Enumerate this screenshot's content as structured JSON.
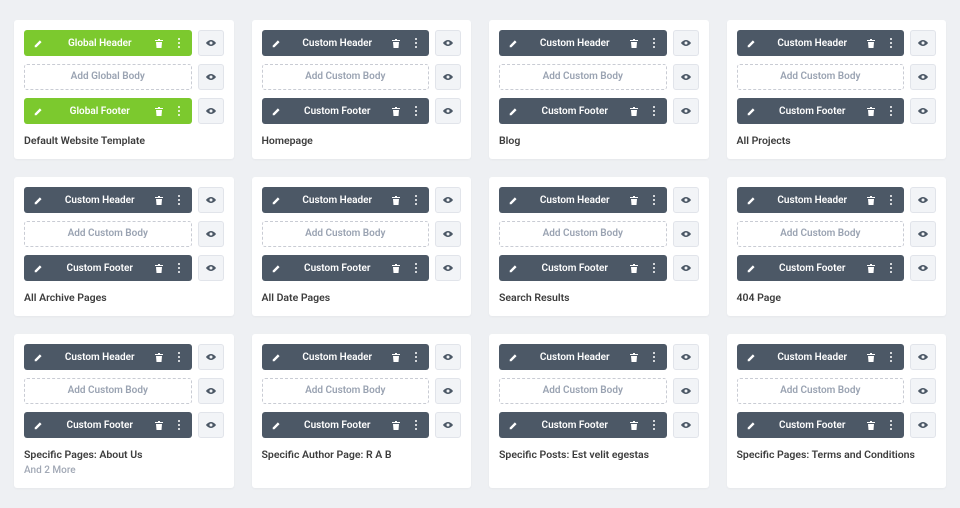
{
  "labels": {
    "and_more": "And 2 More"
  },
  "templates": [
    {
      "title": "Default Website Template",
      "header_label": "Global Header",
      "body_label": "Add Global Body",
      "footer_label": "Global Footer",
      "color": "green",
      "subtitle": ""
    },
    {
      "title": "Homepage",
      "header_label": "Custom Header",
      "body_label": "Add Custom Body",
      "footer_label": "Custom Footer",
      "color": "dark",
      "subtitle": ""
    },
    {
      "title": "Blog",
      "header_label": "Custom Header",
      "body_label": "Add Custom Body",
      "footer_label": "Custom Footer",
      "color": "dark",
      "subtitle": ""
    },
    {
      "title": "All Projects",
      "header_label": "Custom Header",
      "body_label": "Add Custom Body",
      "footer_label": "Custom Footer",
      "color": "dark",
      "subtitle": ""
    },
    {
      "title": "All Archive Pages",
      "header_label": "Custom Header",
      "body_label": "Add Custom Body",
      "footer_label": "Custom Footer",
      "color": "dark",
      "subtitle": ""
    },
    {
      "title": "All Date Pages",
      "header_label": "Custom Header",
      "body_label": "Add Custom Body",
      "footer_label": "Custom Footer",
      "color": "dark",
      "subtitle": ""
    },
    {
      "title": "Search Results",
      "header_label": "Custom Header",
      "body_label": "Add Custom Body",
      "footer_label": "Custom Footer",
      "color": "dark",
      "subtitle": ""
    },
    {
      "title": "404 Page",
      "header_label": "Custom Header",
      "body_label": "Add Custom Body",
      "footer_label": "Custom Footer",
      "color": "dark",
      "subtitle": ""
    },
    {
      "title": "Specific Pages: About Us",
      "header_label": "Custom Header",
      "body_label": "Add Custom Body",
      "footer_label": "Custom Footer",
      "color": "dark",
      "subtitle": "And 2 More"
    },
    {
      "title": "Specific Author Page: R A B",
      "header_label": "Custom Header",
      "body_label": "Add Custom Body",
      "footer_label": "Custom Footer",
      "color": "dark",
      "subtitle": ""
    },
    {
      "title": "Specific Posts: Est velit egestas",
      "header_label": "Custom Header",
      "body_label": "Add Custom Body",
      "footer_label": "Custom Footer",
      "color": "dark",
      "subtitle": ""
    },
    {
      "title": "Specific Pages: Terms and Conditions",
      "header_label": "Custom Header",
      "body_label": "Add Custom Body",
      "footer_label": "Custom Footer",
      "color": "dark",
      "subtitle": ""
    }
  ]
}
